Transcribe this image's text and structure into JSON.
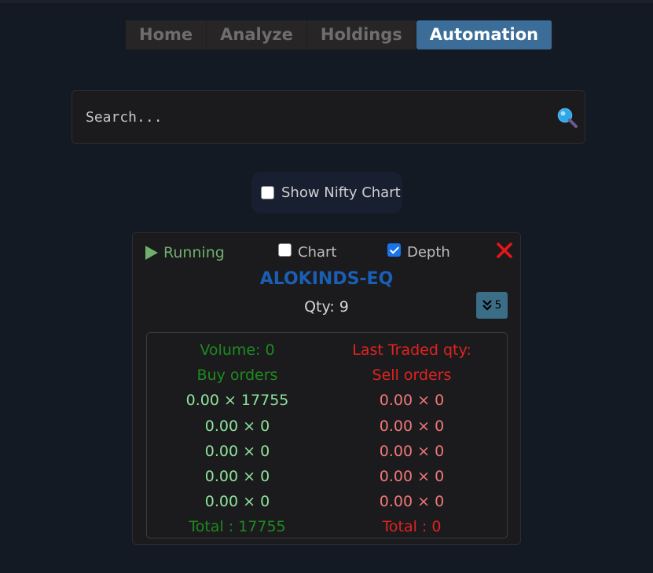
{
  "nav": {
    "tabs": [
      {
        "label": "Home",
        "active": false
      },
      {
        "label": "Analyze",
        "active": false
      },
      {
        "label": "Holdings",
        "active": false
      },
      {
        "label": "Automation",
        "active": true
      }
    ]
  },
  "search": {
    "placeholder": "Search...",
    "value": "",
    "icon": "search-icon"
  },
  "nifty_toggle": {
    "label": "Show Nifty Chart",
    "checked": false
  },
  "card": {
    "status": "Running",
    "chart_option": {
      "label": "Chart",
      "checked": false
    },
    "depth_option": {
      "label": "Depth",
      "checked": true
    },
    "symbol": "ALOKINDS-EQ",
    "qty": "Qty: 9",
    "depth_button_count": "5",
    "depth": {
      "volume": "Volume: 0",
      "last_traded_qty": "Last Traded qty:",
      "buy_header": "Buy orders",
      "sell_header": "Sell orders",
      "buy_orders": [
        "0.00 × 17755",
        "0.00 × 0",
        "0.00 × 0",
        "0.00 × 0",
        "0.00 × 0"
      ],
      "sell_orders": [
        "0.00 × 0",
        "0.00 × 0",
        "0.00 × 0",
        "0.00 × 0",
        "0.00 × 0"
      ],
      "buy_total": "Total : 17755",
      "sell_total": "Total : 0"
    }
  },
  "colors": {
    "active_tab": "#3b6d98",
    "running": "#6fae6b",
    "symbol": "#1a5fb4",
    "buy": "#1e8a1e",
    "sell": "#e0231f",
    "close": "#e8141a"
  }
}
